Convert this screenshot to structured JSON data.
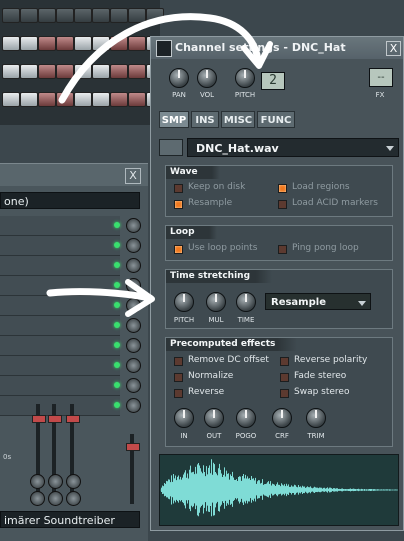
{
  "channel_settings": {
    "title": "Channel settings - DNC_Hat",
    "close": "X",
    "knobs": [
      {
        "label": "PAN"
      },
      {
        "label": "VOL"
      },
      {
        "label": "PITCH"
      }
    ],
    "lcd_value": "2",
    "fx_label": "FX",
    "tabs": [
      "SMP",
      "INS",
      "MISC",
      "FUNC"
    ],
    "active_tab": "SMP",
    "sample_file": "DNC_Hat.wav",
    "wave": {
      "title": "Wave",
      "options": [
        {
          "label": "Keep on disk",
          "checked": false,
          "enabled": false
        },
        {
          "label": "Load regions",
          "checked": true,
          "enabled": false
        },
        {
          "label": "Resample",
          "checked": true,
          "enabled": false
        },
        {
          "label": "Load ACID markers",
          "checked": false,
          "enabled": false
        }
      ]
    },
    "loop": {
      "title": "Loop",
      "options": [
        {
          "label": "Use loop points",
          "checked": true,
          "enabled": false
        },
        {
          "label": "Ping pong loop",
          "checked": false,
          "enabled": false
        }
      ]
    },
    "time_stretching": {
      "title": "Time stretching",
      "knobs": [
        "PITCH",
        "MUL",
        "TIME"
      ],
      "mode": "Resample"
    },
    "precomputed": {
      "title": "Precomputed effects",
      "options": [
        {
          "label": "Remove DC offset",
          "checked": false
        },
        {
          "label": "Reverse polarity",
          "checked": false
        },
        {
          "label": "Normalize",
          "checked": false
        },
        {
          "label": "Fade stereo",
          "checked": false
        },
        {
          "label": "Reverse",
          "checked": false
        },
        {
          "label": "Swap stereo",
          "checked": false
        }
      ],
      "knobs": [
        "IN",
        "OUT",
        "POGO",
        "CRF",
        "TRIM"
      ]
    }
  },
  "mixer": {
    "close": "X",
    "selected": "one)",
    "footer_select": "imärer Soundtreiber",
    "strip_label": "0s"
  },
  "colors": {
    "accent_checkbox": "#f0781e",
    "led": "#39e06e",
    "waveform": "#7fdcd6"
  }
}
